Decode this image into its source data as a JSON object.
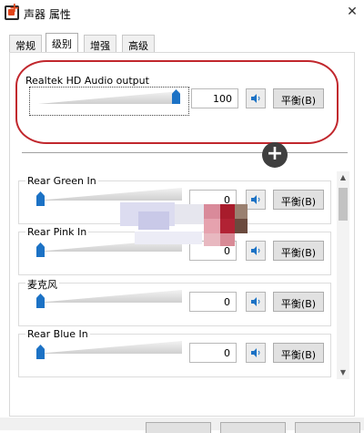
{
  "window": {
    "title": "声器 属性",
    "close_glyph": "✕"
  },
  "tabs": [
    "常规",
    "级别",
    "增强",
    "高级"
  ],
  "active_tab_index": 1,
  "master": {
    "label": "Realtek HD Audio output",
    "value": "100",
    "level_percent": 100,
    "balance_label": "平衡(B)"
  },
  "add_button_glyph": "+",
  "channels": [
    {
      "label": "Rear Green In",
      "value": "0",
      "level_percent": 0,
      "balance_label": "平衡(B)"
    },
    {
      "label": "Rear Pink In",
      "value": "0",
      "level_percent": 0,
      "balance_label": "平衡(B)"
    },
    {
      "label": "麦克风",
      "value": "0",
      "level_percent": 0,
      "balance_label": "平衡(B)"
    },
    {
      "label": "Rear Blue In",
      "value": "0",
      "level_percent": 0,
      "balance_label": "平衡(B)"
    }
  ],
  "scrollbar": {
    "up_glyph": "▲",
    "down_glyph": "▼"
  },
  "colors": {
    "accent_blue": "#1c72c5",
    "highlight_red": "#c1272d",
    "add_button": "#3f3f3f"
  }
}
